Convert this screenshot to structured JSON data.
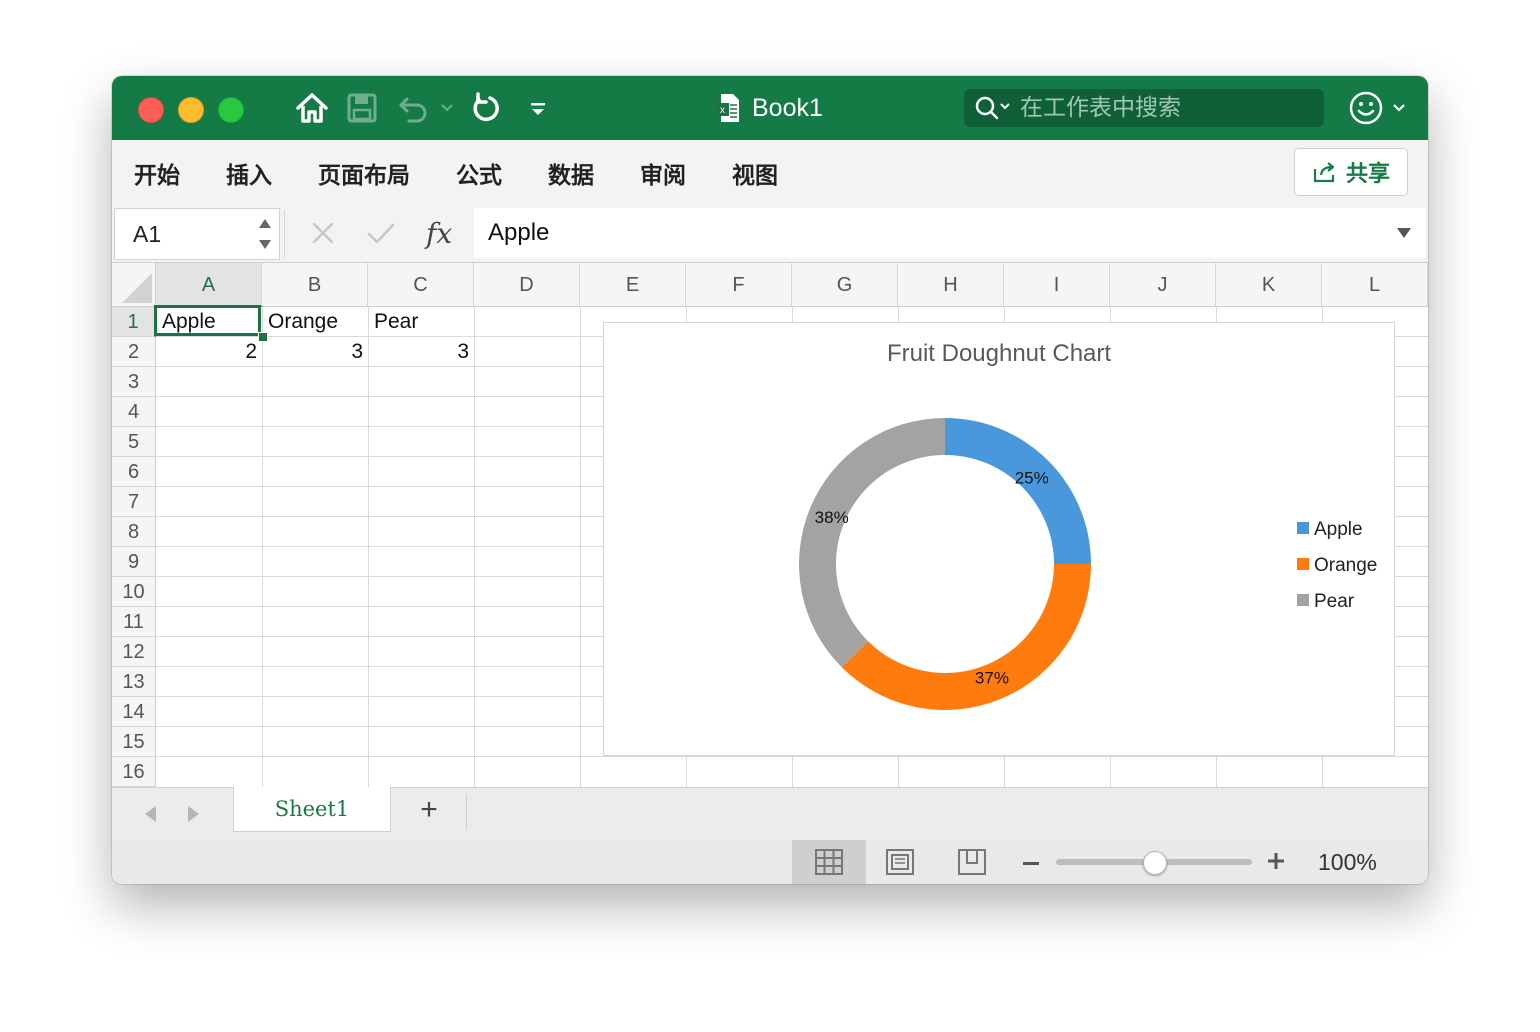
{
  "window": {
    "title": "Book1",
    "search_placeholder": "在工作表中搜索"
  },
  "ribbon": {
    "tabs": [
      "开始",
      "插入",
      "页面布局",
      "公式",
      "数据",
      "审阅",
      "视图"
    ],
    "share_label": "共享"
  },
  "formula_bar": {
    "name_box": "A1",
    "formula": "Apple",
    "fx_label": "fx"
  },
  "grid": {
    "columns": [
      "A",
      "B",
      "C",
      "D",
      "E",
      "F",
      "G",
      "H",
      "I",
      "J",
      "K",
      "L"
    ],
    "rows": [
      "1",
      "2",
      "3",
      "4",
      "5",
      "6",
      "7",
      "8",
      "9",
      "10",
      "11",
      "12",
      "13",
      "14",
      "15",
      "16"
    ],
    "selected_cell": "A1",
    "cells": {
      "A1": "Apple",
      "B1": "Orange",
      "C1": "Pear",
      "A2": "2",
      "B2": "3",
      "C2": "3"
    }
  },
  "chart_data": {
    "type": "pie",
    "subtype": "doughnut",
    "title": "Fruit Doughnut Chart",
    "categories": [
      "Apple",
      "Orange",
      "Pear"
    ],
    "values": [
      2,
      3,
      3
    ],
    "data_labels": [
      "25%",
      "37%",
      "38%"
    ],
    "colors": [
      "#4a98dc",
      "#ff7b0e",
      "#a3a3a3"
    ],
    "legend": "right"
  },
  "sheet_tabs": {
    "tabs": [
      "Sheet1"
    ],
    "active": "Sheet1",
    "add_label": "+"
  },
  "status_bar": {
    "zoom": "100%",
    "zoom_fraction": 0.5
  },
  "colors": {
    "accent": "#147a46",
    "selection": "#1e7145"
  }
}
